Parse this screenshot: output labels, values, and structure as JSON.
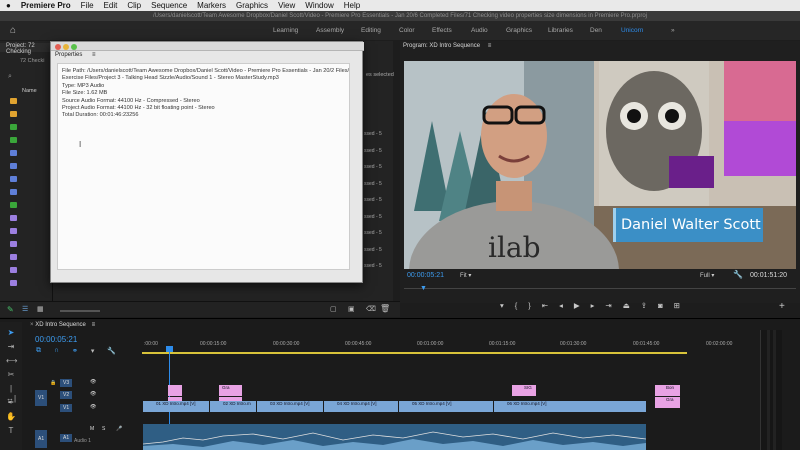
{
  "menubar": {
    "apple": "",
    "app": "Premiere Pro",
    "items": [
      "File",
      "Edit",
      "Clip",
      "Sequence",
      "Markers",
      "Graphics",
      "View",
      "Window",
      "Help"
    ]
  },
  "titlebar": {
    "text": "/Users/danielscott/Team Awesome Dropbox/Daniel Scott/Video - Premiere Pro Essentials - Jan 20/6 Completed Files/71 Checking video properties size dimensions in Premiere Pro.prproj"
  },
  "workspaces": [
    "Learning",
    "Assembly",
    "Editing",
    "Color",
    "Effects",
    "Audio",
    "Graphics",
    "Libraries",
    "Den",
    "Unicorn",
    "»"
  ],
  "workspace_active": "Unicorn",
  "project": {
    "tab": "Project: 72 Checking",
    "sub": "72 Checki",
    "name_col": "Name",
    "selected_note": "es selected",
    "pressed_rows": [
      "ssed - 5",
      "ssed - 5",
      "ssed - 5",
      "ssed - 5",
      "ssed - 5",
      "ssed - 5",
      "ssed - 5",
      "ssed - 5",
      "ssed - 5"
    ]
  },
  "properties": {
    "title": "Properties",
    "lines": [
      "File Path: /Users/danielscott/Team Awesome Dropbox/Daniel Scott/Video - Premiere Pro Essentials - Jan 20/2 Files/",
      "Exercise Files/Project 3 - Talking Head Sizzle/Audio/Sound 1 - Stereo MasterStudy.mp3",
      "Type: MP3 Audio",
      "File Size: 1.62 MB",
      "Source Audio Format: 44100 Hz - Compressed - Stereo",
      "Project Audio Format: 44100 Hz - 32 bit floating point - Stereo",
      "Total Duration: 00:01:46:23256"
    ]
  },
  "program": {
    "tab": "Program: XD Intro Sequence",
    "lower_third": "Daniel Walter Scott",
    "tshirt": "ilab",
    "timecode": "00:00:05:21",
    "fit": "Fit",
    "quality": "Full",
    "duration": "00:01:51:20"
  },
  "timeline": {
    "tab": "XD Intro Sequence",
    "timecode": "00:00:05:21",
    "ruler": [
      ":00:00",
      "00:00:15:00",
      "00:00:30:00",
      "00:00:45:00",
      "00:01:00:00",
      "00:01:15:00",
      "00:01:30:00",
      "00:01:45:00",
      "00:02:00:00"
    ],
    "tracks": [
      "V3",
      "V2",
      "V1",
      "A1"
    ],
    "track_targets": [
      "V1",
      "A1"
    ],
    "audio_label": "Audio 1",
    "v1_clips": [
      "01 XD Intro.mp4 [V]",
      "02 XD Intro.m",
      "03 XD Intro.mp4 [V]",
      "04 XD Intro.mp4 [V]",
      "05 XD Intro.mp4 [V]",
      "06 XD Intro.mp4 [V]"
    ],
    "v3_clips": [
      "",
      "Gra",
      "SIG",
      "Bon"
    ],
    "v2_clips": [
      "",
      "Gra"
    ],
    "colors": {
      "video": "#7aa6d6",
      "graphic": "#e8a2e4",
      "audio": "#3f7fb0",
      "playhead": "#2d8ceb"
    }
  }
}
